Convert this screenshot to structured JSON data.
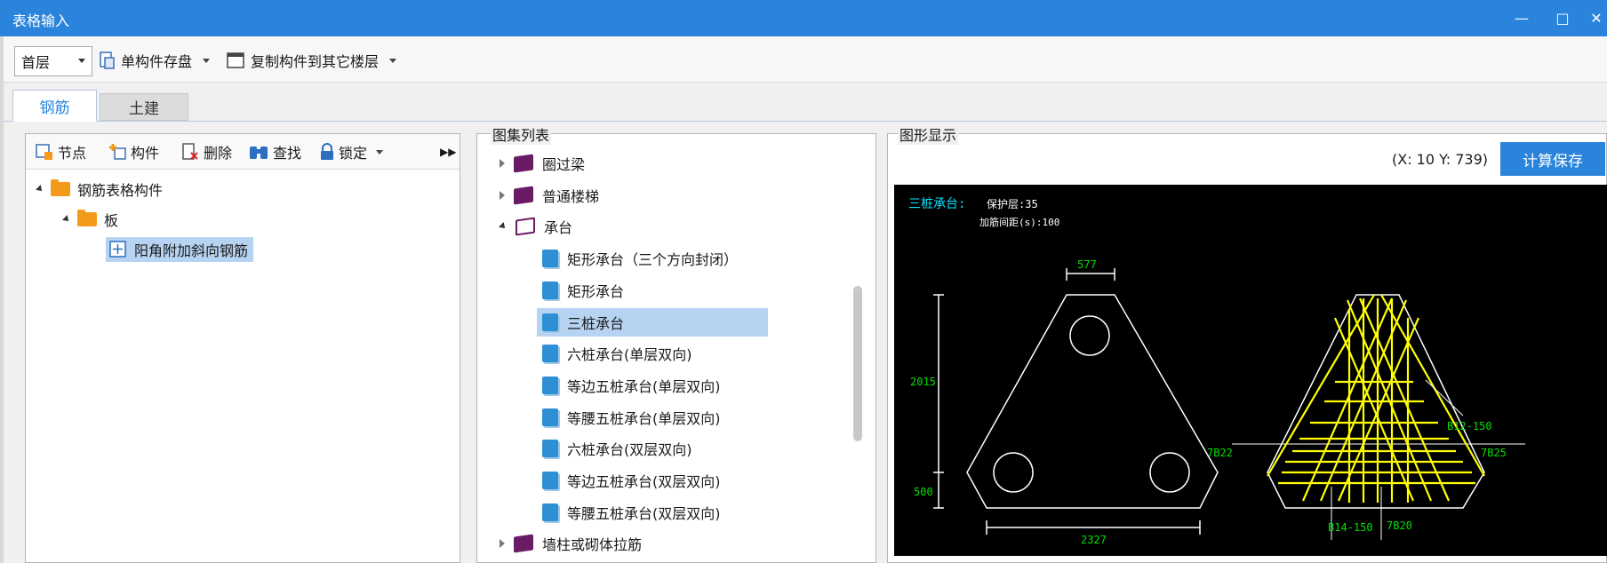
{
  "window": {
    "title": "表格输入"
  },
  "toolbar": {
    "floor": "首层",
    "save_component": "单构件存盘",
    "copy_component": "复制构件到其它楼层"
  },
  "tabs": [
    {
      "label": "钢筋",
      "active": true
    },
    {
      "label": "土建",
      "active": false
    }
  ],
  "left_toolbar": {
    "node": "节点",
    "component": "构件",
    "delete": "删除",
    "find": "查找",
    "lock": "锁定"
  },
  "tree": {
    "root": "钢筋表格构件",
    "child": "板",
    "leaf": "阳角附加斜向钢筋"
  },
  "atlas": {
    "label": "图集列表",
    "items": [
      {
        "label": "圈过梁",
        "type": "book-closed",
        "level": 0
      },
      {
        "label": "普通楼梯",
        "type": "book-closed",
        "level": 0
      },
      {
        "label": "承台",
        "type": "book-open",
        "level": 0
      },
      {
        "label": "矩形承台（三个方向封闭）",
        "type": "page",
        "level": 1
      },
      {
        "label": "矩形承台",
        "type": "page",
        "level": 1
      },
      {
        "label": "三桩承台",
        "type": "page",
        "level": 1,
        "selected": true
      },
      {
        "label": "六桩承台(单层双向)",
        "type": "page",
        "level": 1
      },
      {
        "label": "等边五桩承台(单层双向)",
        "type": "page",
        "level": 1
      },
      {
        "label": "等腰五桩承台(单层双向)",
        "type": "page",
        "level": 1
      },
      {
        "label": "六桩承台(双层双向)",
        "type": "page",
        "level": 1
      },
      {
        "label": "等边五桩承台(双层双向)",
        "type": "page",
        "level": 1
      },
      {
        "label": "等腰五桩承台(双层双向)",
        "type": "page",
        "level": 1
      },
      {
        "label": "墙柱或砌体拉筋",
        "type": "book-closed",
        "level": 0
      }
    ]
  },
  "graphic": {
    "label": "图形显示",
    "coord": "(X: 10 Y: 739)",
    "calc_save": "计算保存",
    "drawing": {
      "title": "三桩承台:",
      "cover": "保护层:35",
      "spacing": "加筋间距(s):100",
      "dim_top": "577",
      "dim_height": "2015",
      "dim_base": "500",
      "dim_width": "2327",
      "rebar_1": "B12-150",
      "rebar_2": "7B22",
      "rebar_3": "7B25",
      "rebar_4": "B14-150",
      "rebar_5": "7B20"
    }
  },
  "colors": {
    "accent": "#2b84dc",
    "selection": "#b7d3f2",
    "drawing_green": "#00e000",
    "drawing_cyan": "#00e5ff",
    "drawing_yellow": "#ffff00"
  }
}
